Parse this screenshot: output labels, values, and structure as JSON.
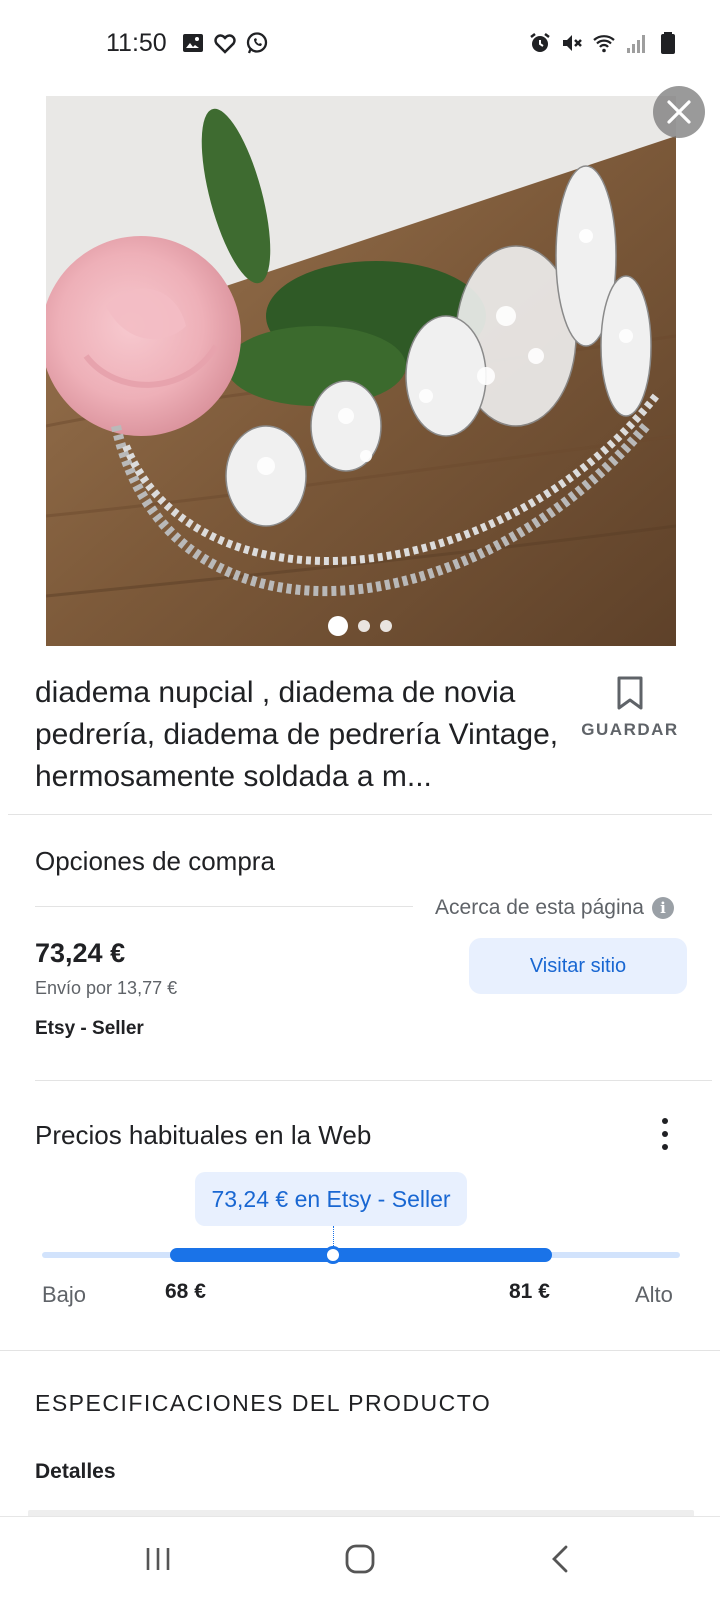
{
  "status_bar": {
    "time": "11:50",
    "left_icons": [
      "gallery-icon",
      "heart-icon",
      "whatsapp-icon"
    ],
    "right_icons": [
      "alarm-icon",
      "mute-icon",
      "wifi-icon",
      "signal-icon",
      "battery-icon"
    ]
  },
  "product": {
    "image": "tiara-with-rose-photo",
    "carousel": {
      "count": 3,
      "active": 1
    },
    "title": "diadema nupcial , diadema de novia pedrería, diadema de pedrería Vintage, hermosamente soldada a m...",
    "save_label": "GUARDAR"
  },
  "purchase": {
    "heading": "Opciones de compra",
    "about_label": "Acerca de esta página",
    "price": "73,24 €",
    "shipping": "Envío por 13,77 €",
    "seller": "Etsy - Seller",
    "visit_label": "Visitar sitio"
  },
  "price_range": {
    "heading": "Precios habituales en la Web",
    "tooltip": "73,24 € en Etsy - Seller",
    "low_label": "Bajo",
    "high_label": "Alto",
    "low_value": "68 €",
    "high_value": "81 €",
    "current": 73.24,
    "accent_color": "#1a73e8"
  },
  "specs": {
    "heading": "ESPECIFICACIONES DEL PRODUCTO",
    "details_label": "Detalles"
  },
  "nav": {
    "buttons": [
      "recent-apps-icon",
      "home-icon",
      "back-icon"
    ]
  }
}
